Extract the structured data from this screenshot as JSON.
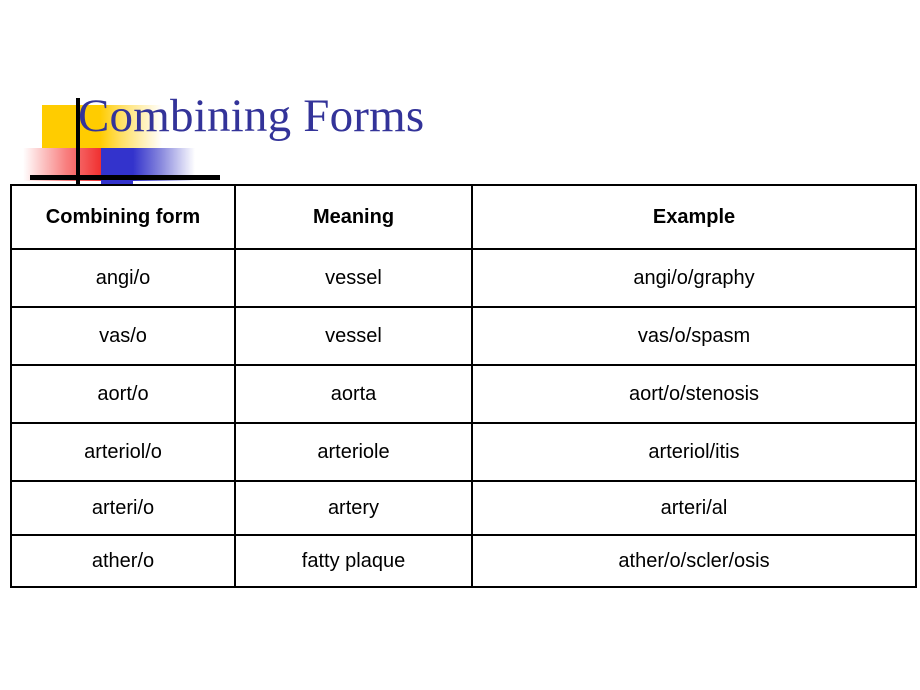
{
  "slide": {
    "title": "Combining Forms",
    "title_color": "#333399",
    "background": "#ffffff"
  },
  "decoration": {
    "name": "powerpoint-title-logo",
    "yellow": "#FFCC00",
    "red": "#F03030",
    "blue": "#3333CC",
    "rule": "#000000"
  },
  "table": {
    "columns": [
      "Combining form",
      "Meaning",
      "Example"
    ],
    "rows": [
      {
        "combining_form": "angi/o",
        "meaning": "vessel",
        "example": "angi/o/graphy"
      },
      {
        "combining_form": "vas/o",
        "meaning": "vessel",
        "example": "vas/o/spasm"
      },
      {
        "combining_form": "aort/o",
        "meaning": "aorta",
        "example": "aort/o/stenosis"
      },
      {
        "combining_form": "arteriol/o",
        "meaning": "arteriole",
        "example": "arteriol/itis"
      },
      {
        "combining_form": "arteri/o",
        "meaning": "artery",
        "example": "arteri/al"
      },
      {
        "combining_form": "ather/o",
        "meaning": "fatty plaque",
        "example": "ather/o/scler/osis"
      }
    ]
  }
}
